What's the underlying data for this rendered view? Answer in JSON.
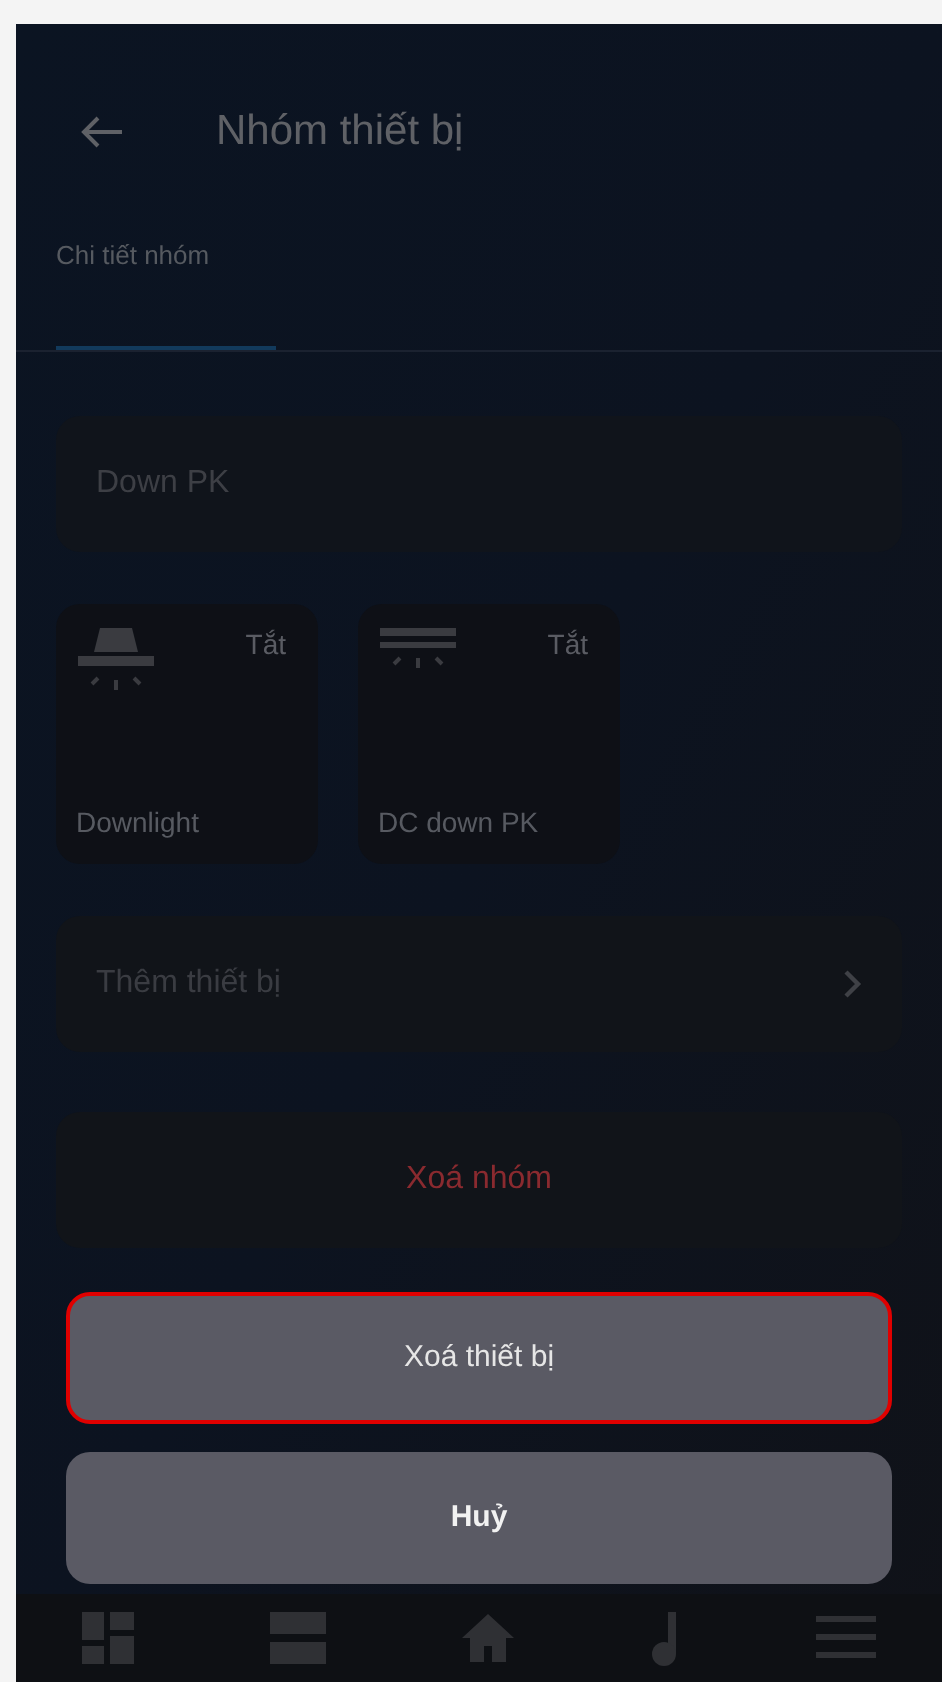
{
  "header": {
    "title": "Nhóm thiết bị"
  },
  "tabs": [
    {
      "label": "Chi tiết nhóm",
      "selected": true
    }
  ],
  "group_name": {
    "value": "Down PK"
  },
  "devices": [
    {
      "kind": "downlight",
      "status": "Tắt",
      "name": "Downlight"
    },
    {
      "kind": "strip",
      "status": "Tắt",
      "name": "DC down PK"
    }
  ],
  "add_device": {
    "label": "Thêm thiết bị"
  },
  "delete_group": {
    "label": "Xoá nhóm"
  },
  "action_sheet": [
    {
      "label": "Xoá thiết bị",
      "kind": "destructive",
      "selected": true
    },
    {
      "label": "Huỷ",
      "kind": "cancel",
      "selected": false
    }
  ]
}
